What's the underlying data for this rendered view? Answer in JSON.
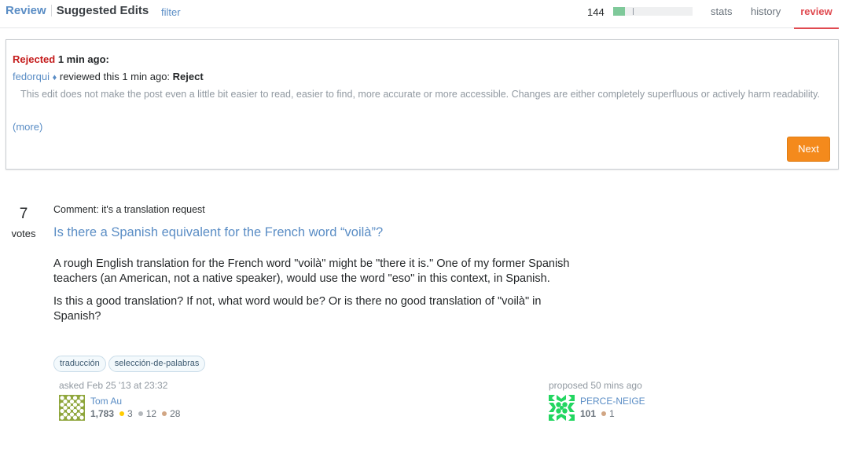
{
  "header": {
    "review_label": "Review",
    "section_title": "Suggested Edits",
    "filter_label": "filter",
    "queue_count": "144",
    "queue_progress_fraction": 0.15,
    "queue_marker_fraction": 0.25,
    "tabs": [
      {
        "label": "stats",
        "active": false
      },
      {
        "label": "history",
        "active": false
      },
      {
        "label": "review",
        "active": true
      }
    ]
  },
  "result": {
    "status": "Rejected",
    "status_time": "1 min ago:",
    "reviewer": "fedorqui",
    "reviewer_mod_symbol": "♦",
    "reviewed_text": "reviewed this 1 min ago:",
    "action": "Reject",
    "reason": "This edit does not make the post even a little bit easier to read, easier to find, more accurate or more accessible. Changes are either completely superfluous or actively harm readability.",
    "more_label": "(more)",
    "next_label": "Next"
  },
  "question": {
    "votes": "7",
    "votes_label": "votes",
    "comment": "Comment: it's a translation request",
    "title": "Is there a Spanish equivalent for the French word “voilà”?",
    "body": [
      "A rough English translation for the French word \"voilà\" might be \"there it is.\" One of my former Spanish teachers (an American, not a native speaker), would use the word \"eso\" in this context, in Spanish.",
      "Is this a good translation? If not, what word would be? Or is there no good translation of \"voilà\" in Spanish?"
    ],
    "tags": [
      "traducción",
      "selección-de-palabras"
    ],
    "asked": {
      "time": "asked Feb 25 '13 at 23:32",
      "user": "Tom Au",
      "reputation": "1,783",
      "gold": "3",
      "silver": "12",
      "bronze": "28",
      "avatar_color": "#8fa63c"
    },
    "proposed": {
      "time": "proposed 50 mins ago",
      "user": "PERCE-NEIGE",
      "reputation": "101",
      "bronze": "1",
      "avatar_color": "#22d660"
    }
  }
}
